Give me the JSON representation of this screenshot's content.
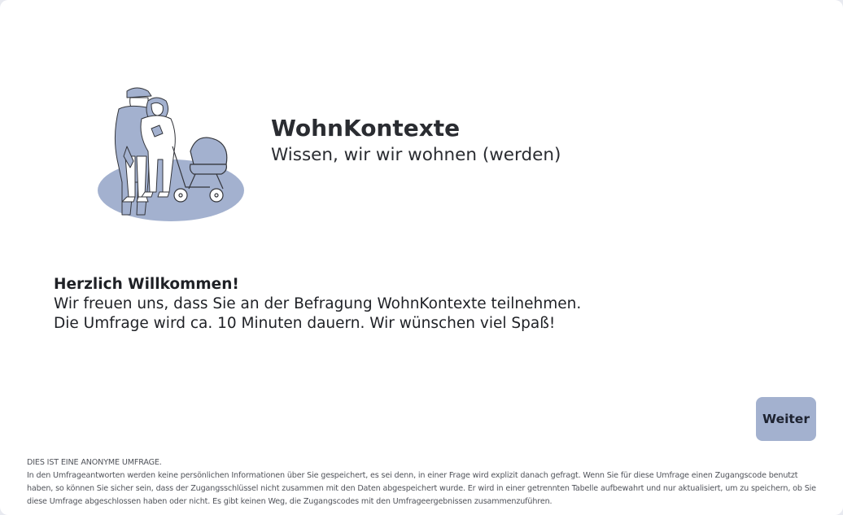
{
  "header": {
    "title": "WohnKontexte",
    "subtitle": "Wissen, wir wir wohnen (werden)"
  },
  "illustration": {
    "icon": "family-with-stroller-illustration",
    "fill_color": "#a3b1cf",
    "stroke_color": "#33353b"
  },
  "welcome": {
    "heading": "Herzlich Willkommen!",
    "line1": "Wir freuen uns, dass Sie an der Befragung WohnKontexte teilnehmen.",
    "line2": "Die Umfrage wird ca. 10 Minuten dauern. Wir wünschen viel Spaß!"
  },
  "navigation": {
    "next_label": "Weiter",
    "button_color": "#a3b1cf"
  },
  "privacy_notice": {
    "title": "DIES IST EINE ANONYME UMFRAGE.",
    "text": "In den Umfrageantworten werden keine persönlichen Informationen über Sie gespeichert, es sei denn, in einer Frage wird explizit danach gefragt. Wenn Sie für diese Umfrage einen Zugangscode benutzt haben, so können Sie sicher sein, dass der Zugangsschlüssel nicht zusammen mit den Daten abgespeichert wurde. Er wird in einer getrennten Tabelle aufbewahrt und nur aktualisiert, um zu speichern, ob Sie diese Umfrage abgeschlossen haben oder nicht. Es gibt keinen Weg, die Zugangscodes mit den Umfrageergebnissen zusammenzuführen."
  }
}
